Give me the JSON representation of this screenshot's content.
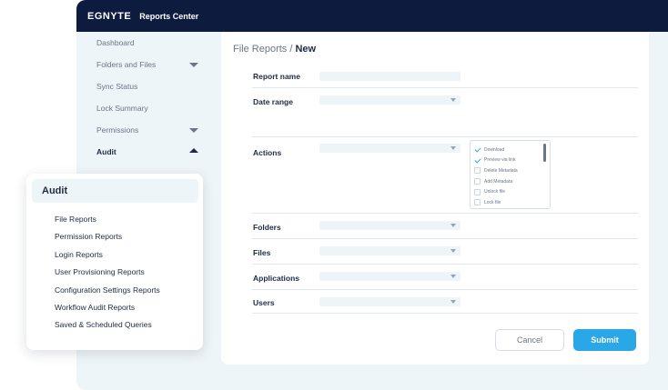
{
  "topbar": {
    "logo": "EGNYTE",
    "app_name": "Reports Center"
  },
  "sidenav": {
    "items": [
      {
        "label": "Dashboard",
        "caret": ""
      },
      {
        "label": "Folders and Files",
        "caret": "down"
      },
      {
        "label": "Sync Status",
        "caret": ""
      },
      {
        "label": "Lock Summary",
        "caret": ""
      },
      {
        "label": "Permissions",
        "caret": "down"
      },
      {
        "label": "Audit",
        "caret": "up",
        "active": true
      }
    ]
  },
  "breadcrumb": {
    "parent": "File Reports",
    "separator": " / ",
    "current": "New"
  },
  "form": {
    "report_name_label": "Report name",
    "date_range_label": "Date range",
    "actions_label": "Actions",
    "folders_label": "Folders",
    "files_label": "Files",
    "applications_label": "Applications",
    "users_label": "Users",
    "actions_options": [
      {
        "label": "Download",
        "checked": true
      },
      {
        "label": "Preview via link",
        "checked": true
      },
      {
        "label": "Delete Metadata",
        "checked": false
      },
      {
        "label": "Add Metadata",
        "checked": false
      },
      {
        "label": "Unlock file",
        "checked": false
      },
      {
        "label": "Lock file",
        "checked": false
      }
    ]
  },
  "buttons": {
    "cancel": "Cancel",
    "submit": "Submit"
  },
  "audit_popup": {
    "title": "Audit",
    "items": [
      "File Reports",
      "Permission Reports",
      "Login Reports",
      "User Provisioning Reports",
      "Configuration Settings Reports",
      "Workflow Audit Reports",
      "Saved & Scheduled Queries"
    ]
  },
  "colors": {
    "navy": "#0d1b3e",
    "accent": "#2aa7e6",
    "background": "#eef5f8"
  }
}
